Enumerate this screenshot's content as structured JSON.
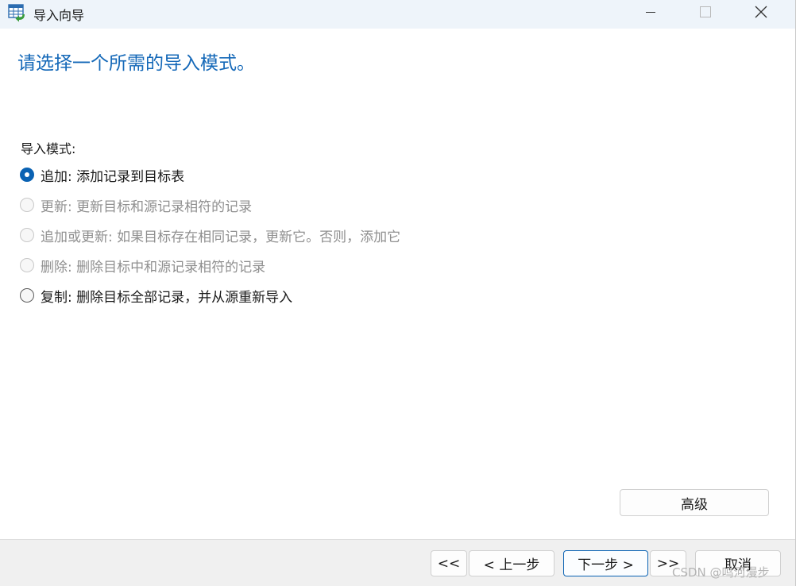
{
  "window": {
    "title": "导入向导",
    "icon": "table-import-icon"
  },
  "header": {
    "title": "请选择一个所需的导入模式。"
  },
  "mode": {
    "label": "导入模式:",
    "options": [
      {
        "label": "追加: 添加记录到目标表",
        "checked": true,
        "enabled": true
      },
      {
        "label": "更新: 更新目标和源记录相符的记录",
        "checked": false,
        "enabled": false
      },
      {
        "label": "追加或更新: 如果目标存在相同记录，更新它。否则，添加它",
        "checked": false,
        "enabled": false
      },
      {
        "label": "删除: 删除目标中和源记录相符的记录",
        "checked": false,
        "enabled": false
      },
      {
        "label": "复制: 删除目标全部记录，并从源重新导入",
        "checked": false,
        "enabled": true
      }
    ]
  },
  "buttons": {
    "advanced": "高级",
    "first": "<<",
    "prev": "< 上一步",
    "next": "下一步 >",
    "last": ">>",
    "cancel": "取消"
  },
  "watermark": "CSDN @鸣河漫步",
  "colors": {
    "accent": "#0a62b3",
    "header_text": "#1468b8",
    "titlebar_bg": "#eef4fa",
    "disabled_text": "#8f8f8f"
  }
}
